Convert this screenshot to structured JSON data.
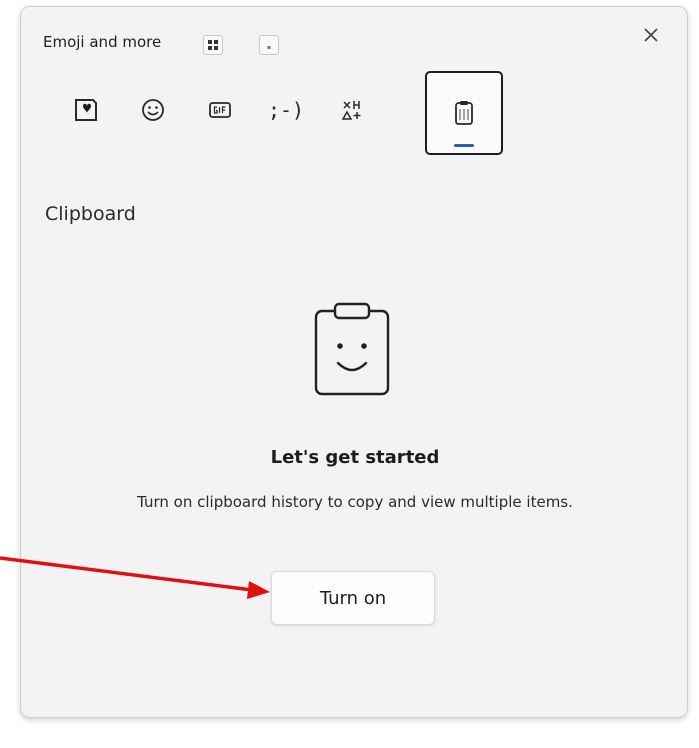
{
  "panel": {
    "title": "Emoji and more",
    "view_toggle_icons": [
      "grid-view-icon",
      "compact-view-icon"
    ],
    "close_icon": "close-icon"
  },
  "tabs": [
    {
      "id": "kaomoji-favorites",
      "icon": "heart-sticker-icon",
      "active": false
    },
    {
      "id": "emoji",
      "icon": "smiley-icon",
      "active": false
    },
    {
      "id": "gif",
      "icon": "gif-icon",
      "active": false
    },
    {
      "id": "kaomoji",
      "icon": "kaomoji-icon",
      "glyph": ";-)",
      "active": false
    },
    {
      "id": "symbols",
      "icon": "symbols-icon",
      "active": false
    },
    {
      "id": "clipboard",
      "icon": "clipboard-icon",
      "active": true
    }
  ],
  "section": {
    "title": "Clipboard"
  },
  "empty_state": {
    "icon": "smiling-clipboard-icon",
    "heading": "Let's get started",
    "description": "Turn on clipboard history to copy and view multiple items.",
    "button_label": "Turn on"
  },
  "annotation": {
    "arrow_color": "#e01010"
  },
  "colors": {
    "panel_bg": "#f3f3f3",
    "accent": "#2b5db4",
    "active_border": "#1e1e1e"
  }
}
